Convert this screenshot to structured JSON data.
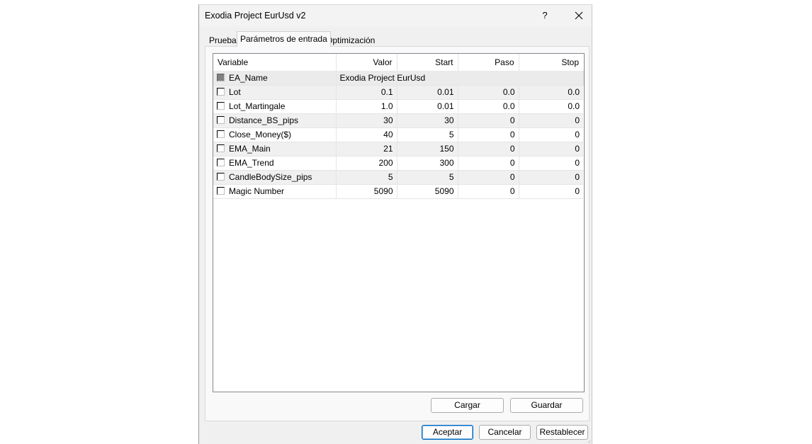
{
  "window": {
    "title": "Exodia Project EurUsd v2",
    "help_label": "?"
  },
  "tabs": [
    {
      "label": "Prueba"
    },
    {
      "label": "Parámetros de entrada"
    },
    {
      "label": "Optimización"
    }
  ],
  "table": {
    "columns": [
      "Variable",
      "Valor",
      "Start",
      "Paso",
      "Stop"
    ],
    "rows": [
      {
        "variable": "EA_Name",
        "valor": "Exodia Project EurUsd",
        "start": "",
        "paso": "",
        "stop": "",
        "checked": false,
        "disabled": true
      },
      {
        "variable": "Lot",
        "valor": "0.1",
        "start": "0.01",
        "paso": "0.0",
        "stop": "0.0",
        "checked": false,
        "disabled": false
      },
      {
        "variable": "Lot_Martingale",
        "valor": "1.0",
        "start": "0.01",
        "paso": "0.0",
        "stop": "0.0",
        "checked": false,
        "disabled": false
      },
      {
        "variable": "Distance_BS_pips",
        "valor": "30",
        "start": "30",
        "paso": "0",
        "stop": "0",
        "checked": false,
        "disabled": false
      },
      {
        "variable": "Close_Money($)",
        "valor": "40",
        "start": "5",
        "paso": "0",
        "stop": "0",
        "checked": false,
        "disabled": false
      },
      {
        "variable": "EMA_Main",
        "valor": "21",
        "start": "150",
        "paso": "0",
        "stop": "0",
        "checked": false,
        "disabled": false
      },
      {
        "variable": "EMA_Trend",
        "valor": "200",
        "start": "300",
        "paso": "0",
        "stop": "0",
        "checked": false,
        "disabled": false
      },
      {
        "variable": "CandleBodySize_pips",
        "valor": "5",
        "start": "5",
        "paso": "0",
        "stop": "0",
        "checked": false,
        "disabled": false
      },
      {
        "variable": "Magic Number",
        "valor": "5090",
        "start": "5090",
        "paso": "0",
        "stop": "0",
        "checked": false,
        "disabled": false
      }
    ]
  },
  "panel_buttons": {
    "load": "Cargar",
    "save": "Guardar"
  },
  "footer_buttons": {
    "ok": "Aceptar",
    "cancel": "Cancelar",
    "reset": "Restablecer"
  },
  "colors": {
    "dialog_bg": "#f0f0f0",
    "primary_border": "#0067c0"
  },
  "icons": {
    "close": "close-icon",
    "help": "help-icon",
    "checkbox": "checkbox-icon",
    "resize": "resize-grip-icon"
  }
}
